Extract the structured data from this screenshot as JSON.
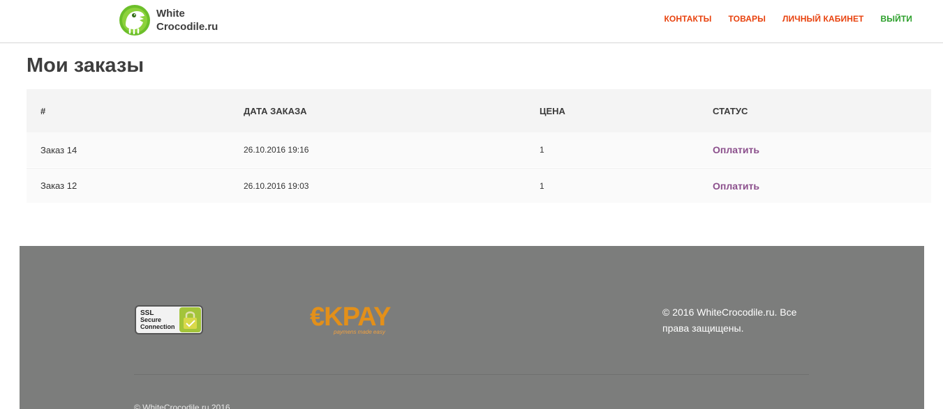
{
  "header": {
    "logo_line1": "White",
    "logo_line2": "Crocodile.ru",
    "nav": [
      {
        "label": "КОНТАКТЫ"
      },
      {
        "label": "ТОВАРЫ"
      },
      {
        "label": "ЛИЧНЫЙ КАБИНЕТ"
      },
      {
        "label": "ВЫЙТИ"
      }
    ]
  },
  "main": {
    "title": "Мои заказы",
    "table": {
      "columns": [
        "#",
        "ДАТА ЗАКАЗА",
        "ЦЕНА",
        "СТАТУС"
      ],
      "rows": [
        {
          "order": "Заказ 14",
          "date": "26.10.2016 19:16",
          "price": "1",
          "status": "Оплатить"
        },
        {
          "order": "Заказ 12",
          "date": "26.10.2016 19:03",
          "price": "1",
          "status": "Оплатить"
        }
      ]
    }
  },
  "footer": {
    "ssl_line1": "SSL",
    "ssl_line2": "Secure",
    "ssl_line3": "Connection",
    "okpay_brand": "€KPAY",
    "okpay_tagline": "paymens made easy",
    "copyright": "© 2016 WhiteCrocodile.ru. Все права защищены.",
    "bottom_text": "© WhiteCrocodile.ru 2016"
  },
  "colors": {
    "nav_accent": "#e8420e",
    "nav_logout": "#2b9f2a",
    "status_link": "#8b4f8c",
    "footer_bg": "#7c7d7c"
  }
}
